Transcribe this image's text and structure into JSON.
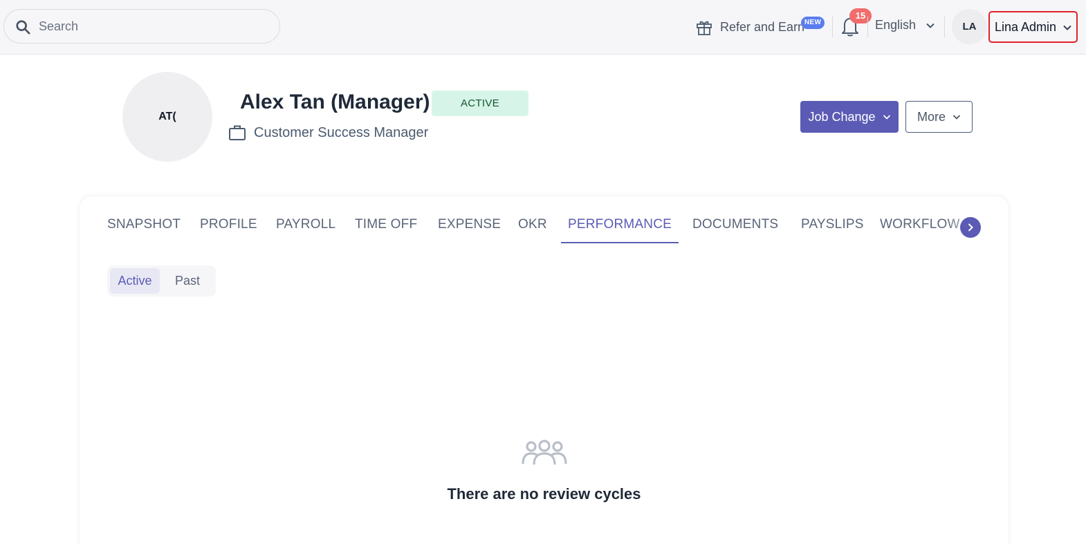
{
  "topbar": {
    "search": {
      "placeholder": "Search",
      "value": "",
      "icon": "search-icon"
    },
    "refer": {
      "label": "Refer and Earn",
      "badge": "NEW",
      "icon": "gift-icon"
    },
    "notifications": {
      "count": "15",
      "icon": "bell-icon"
    },
    "language": {
      "label": "English",
      "icon": "chevron-down-icon"
    },
    "user": {
      "initials": "LA",
      "name": "Lina Admin",
      "icon": "chevron-down-icon"
    }
  },
  "employee": {
    "avatar_initials": "AT(",
    "name": "Alex Tan (Manager)",
    "status": "ACTIVE",
    "job_title": "Customer Success Manager",
    "job_icon": "briefcase-icon"
  },
  "actions": {
    "job_change_label": "Job Change",
    "more_label": "More"
  },
  "tabs": [
    {
      "label": "SNAPSHOT"
    },
    {
      "label": "PROFILE"
    },
    {
      "label": "PAYROLL"
    },
    {
      "label": "TIME OFF"
    },
    {
      "label": "EXPENSE"
    },
    {
      "label": "OKR"
    },
    {
      "label": "PERFORMANCE",
      "active": true
    },
    {
      "label": "DOCUMENTS"
    },
    {
      "label": "PAYSLIPS"
    },
    {
      "label": "WORKFLOW"
    }
  ],
  "performance": {
    "filters": {
      "active_label": "Active",
      "past_label": "Past",
      "selected": "Active"
    },
    "empty_message": "There are no review cycles",
    "empty_icon": "users-group-icon"
  },
  "colors": {
    "accent": "#5b5bb5",
    "status_bg": "#d6f5e8",
    "notification": "#f26b6b",
    "new_badge": "#5b7cf0",
    "highlight_border": "#e0202a"
  }
}
